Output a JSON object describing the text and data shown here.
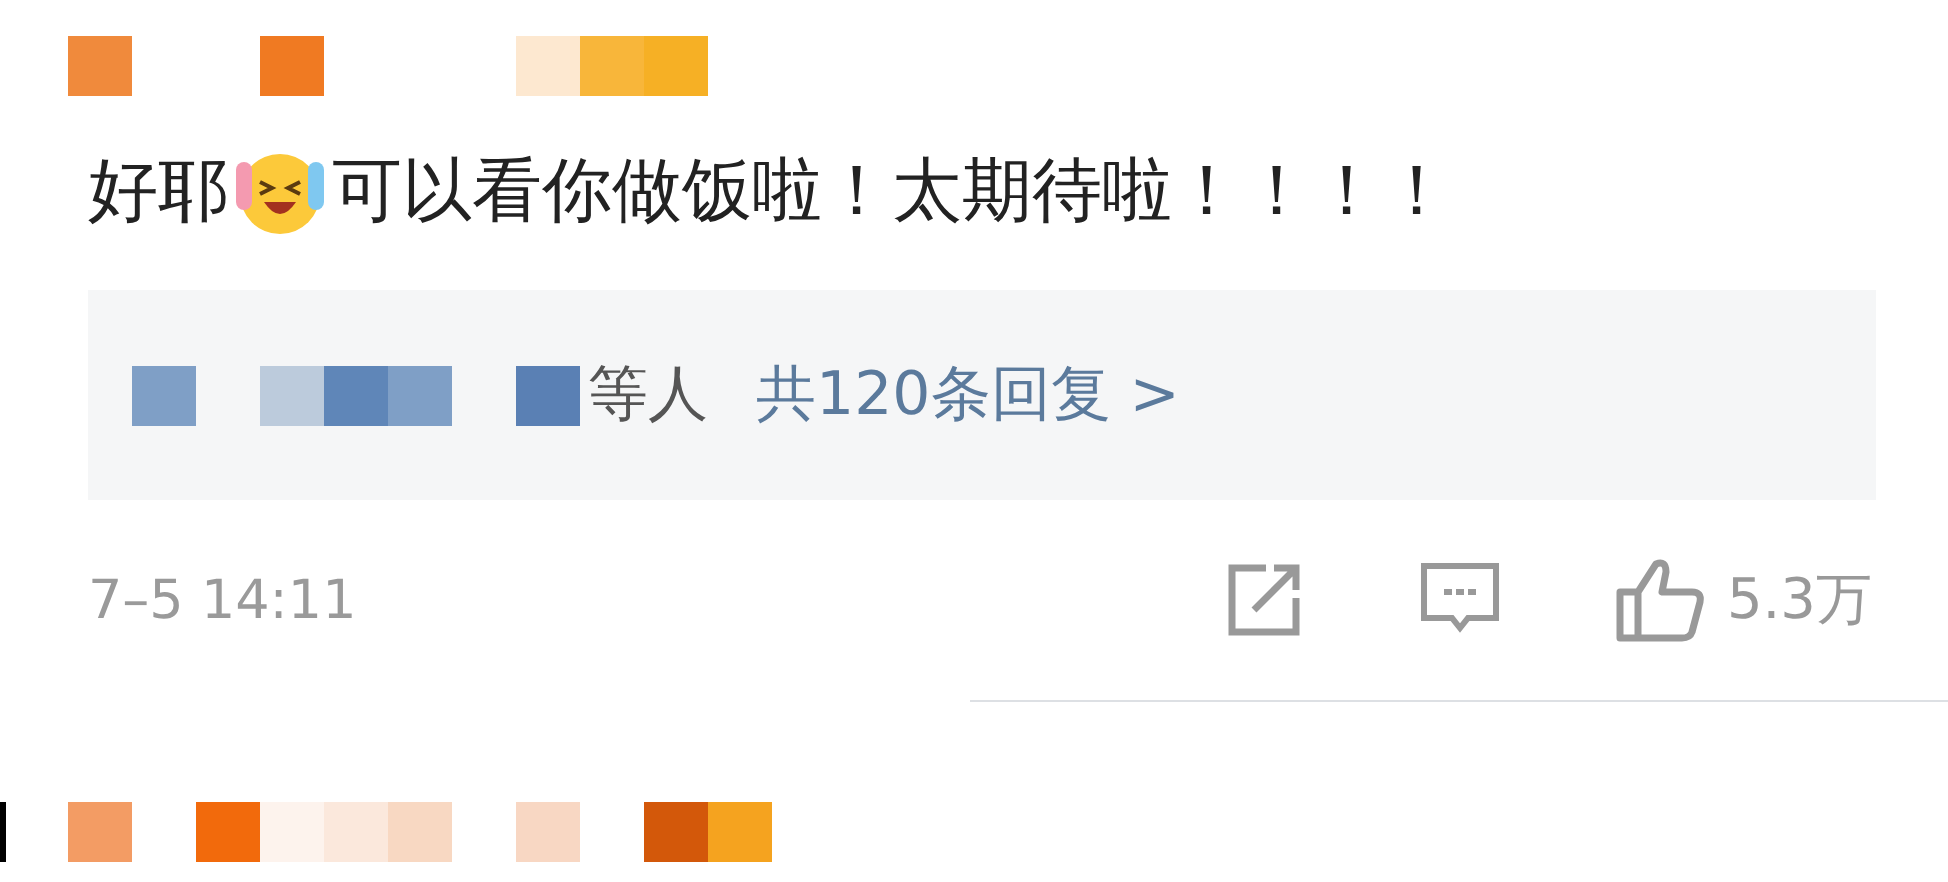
{
  "comment": {
    "text_before": "好耶",
    "text_after": "可以看你做饭啦！太期待啦！！！！",
    "replies": {
      "suffix": "等人",
      "link": "共120条回复 >"
    },
    "time": "7–5 14:11",
    "likes": "5.3万"
  }
}
